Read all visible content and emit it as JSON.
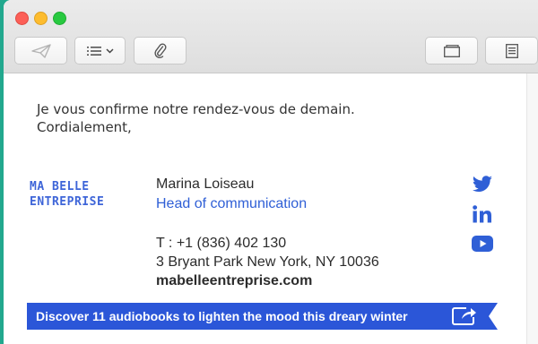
{
  "window": {
    "toolbar": {
      "icons": [
        "send-icon",
        "list-format-icon",
        "chevron-down-icon",
        "paperclip-icon",
        "window-icon",
        "document-icon"
      ]
    }
  },
  "email": {
    "body_lines": [
      "Je vous confirme notre rendez-vous de demain.",
      "Cordialement,"
    ]
  },
  "signature": {
    "logo_lines": [
      "MA BELLE",
      "ENTREPRISE"
    ],
    "name": "Marina Loiseau",
    "role": "Head of communication",
    "phone": "T : +1 (836) 402 130",
    "address": "3 Bryant Park New York, NY 10036",
    "website": "mabelleentreprise.com",
    "social_icons": [
      "twitter-icon",
      "linkedin-icon",
      "youtube-icon"
    ],
    "banner_text": "Discover 11 audiobooks to lighten the mood this dreary winter",
    "colors": {
      "brand_blue": "#2f5fd6",
      "banner_blue": "#2b56d8",
      "desktop_green": "#22a88e"
    }
  }
}
